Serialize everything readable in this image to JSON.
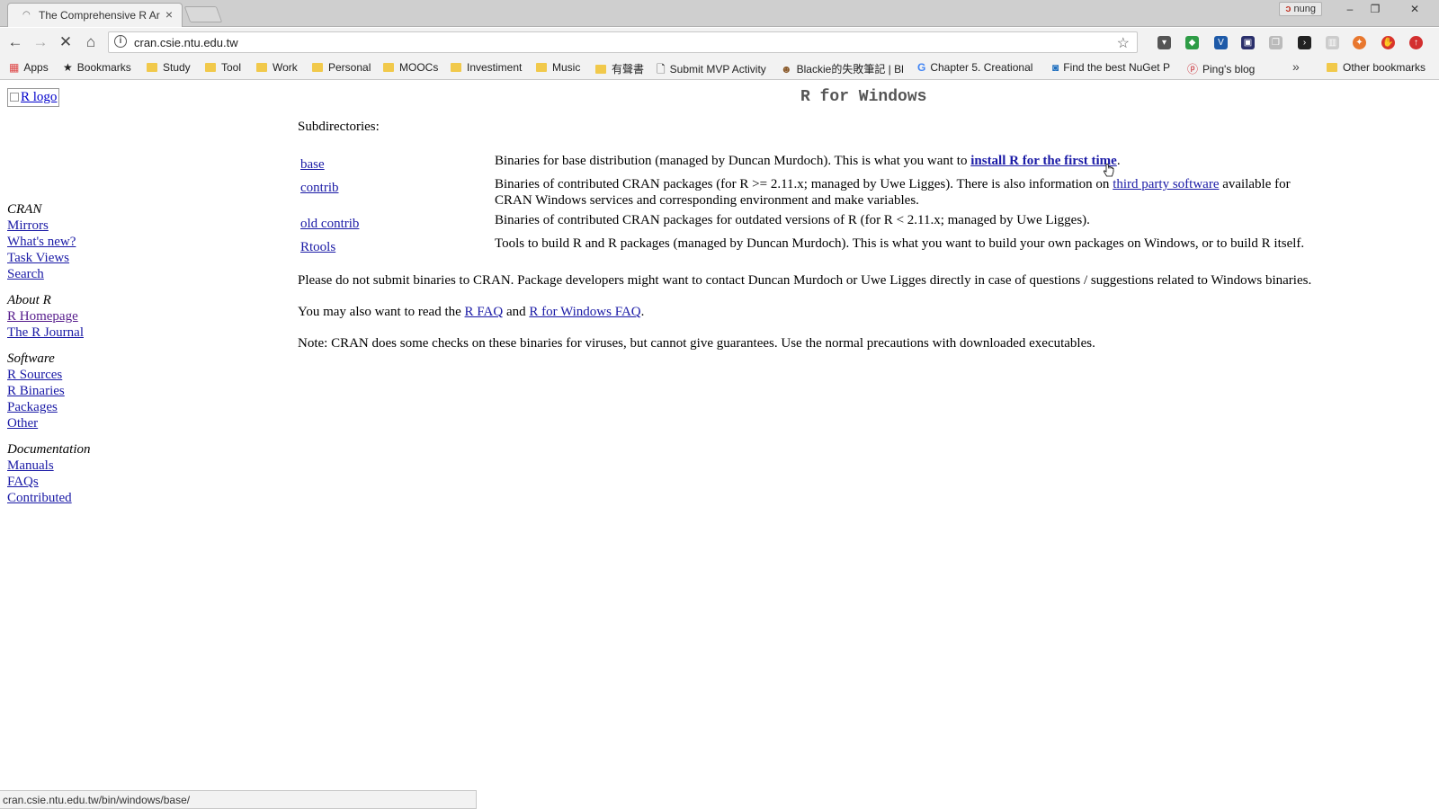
{
  "browser": {
    "tab_title": "The Comprehensive R Ar",
    "tab_close": "×",
    "profile_name": "nung",
    "window_controls": {
      "minimize": "–",
      "restore": "❐",
      "close": "✕"
    },
    "url": "cran.csie.ntu.edu.tw",
    "nav": {
      "back": "←",
      "forward": "→",
      "stop": "✕",
      "home": "⌂"
    }
  },
  "bookmarks": {
    "items": [
      {
        "label": "Apps",
        "icon": "apps-grid-icon"
      },
      {
        "label": "Bookmarks",
        "icon": "star-icon"
      },
      {
        "label": "Study",
        "icon": "folder-icon"
      },
      {
        "label": "Tool",
        "icon": "folder-icon"
      },
      {
        "label": "Work",
        "icon": "folder-icon"
      },
      {
        "label": "Personal",
        "icon": "folder-icon"
      },
      {
        "label": "MOOCs",
        "icon": "folder-icon"
      },
      {
        "label": "Investiment",
        "icon": "folder-icon"
      },
      {
        "label": "Music",
        "icon": "folder-icon"
      },
      {
        "label": "有聲書",
        "icon": "folder-icon"
      },
      {
        "label": "Submit MVP Activity",
        "icon": "page-icon"
      },
      {
        "label": "Blackie的失敗筆記 | Bl",
        "icon": "avatar-icon"
      },
      {
        "label": "Chapter 5. Creational",
        "icon": "google-icon"
      },
      {
        "label": "Find the best NuGet P",
        "icon": "nuget-icon"
      },
      {
        "label": "Ping's blog",
        "icon": "pinterest-icon"
      }
    ],
    "more": "»",
    "other": "Other bookmarks"
  },
  "page": {
    "logo_alt": "R logo",
    "title": "R for Windows",
    "sidebar": {
      "cran": {
        "heading": "CRAN",
        "links": [
          "Mirrors",
          "What's new?",
          "Task Views",
          "Search"
        ]
      },
      "about": {
        "heading": "About R",
        "links": [
          "R Homepage",
          "The R Journal"
        ]
      },
      "software": {
        "heading": "Software",
        "links": [
          "R Sources",
          "R Binaries",
          "Packages",
          "Other"
        ]
      },
      "docs": {
        "heading": "Documentation",
        "links": [
          "Manuals",
          "FAQs",
          "Contributed"
        ]
      }
    },
    "subdirectories_label": "Subdirectories:",
    "subdirs": {
      "base": {
        "name": "base",
        "text": "Binaries for base distribution (managed by Duncan Murdoch). This is what you want to ",
        "link": "install R for the first time",
        "after": "."
      },
      "contrib": {
        "name": "contrib",
        "text": "Binaries of contributed CRAN packages (for R >= 2.11.x; managed by Uwe Ligges). There is also information on ",
        "link": "third party software",
        "after": " available for CRAN Windows services and corresponding environment and make variables."
      },
      "old_contrib": {
        "name": "old contrib",
        "text": "Binaries of contributed CRAN packages for outdated versions of R (for R < 2.11.x; managed by Uwe Ligges)."
      },
      "rtools": {
        "name": "Rtools",
        "text": "Tools to build R and R packages (managed by Duncan Murdoch). This is what you want to build your own packages on Windows, or to build R itself."
      }
    },
    "para1": "Please do not submit binaries to CRAN. Package developers might want to contact Duncan Murdoch or Uwe Ligges directly in case of questions / suggestions related to Windows binaries.",
    "para2": {
      "before": "You may also want to read the ",
      "link1": "R FAQ",
      "mid": " and ",
      "link2": "R for Windows FAQ",
      "after": "."
    },
    "para3": "Note: CRAN does some checks on these binaries for viruses, but cannot give guarantees. Use the normal precautions with downloaded executables."
  },
  "status": {
    "url": "cran.csie.ntu.edu.tw/bin/windows/base/"
  }
}
